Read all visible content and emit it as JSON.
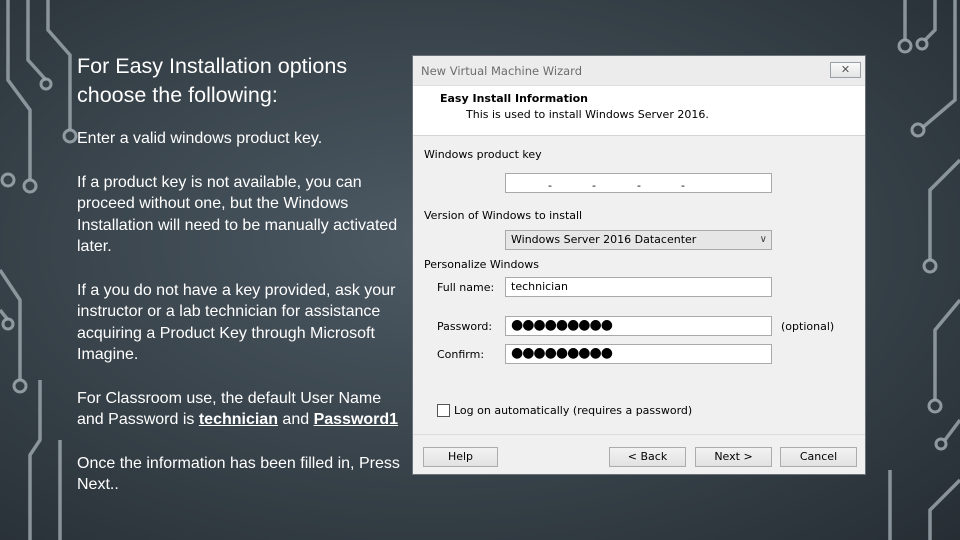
{
  "slide": {
    "heading": "For Easy Installation options choose the following:",
    "p1": "Enter a valid windows product key.",
    "p2": "If a product key is not available, you can proceed without one, but the Windows Installation will need to be manually activated later.",
    "p3": "If a you do not have a key provided, ask your instructor or a lab technician for assistance acquiring a Product Key through Microsoft Imagine.",
    "p4_pre": "For Classroom use,  the default User Name and Password is ",
    "p4_user": "technician",
    "p4_mid": " and ",
    "p4_pass": "Password1",
    "p5": "Once the information has been filled in, Press Next.."
  },
  "dialog": {
    "title": "New Virtual Machine Wizard",
    "close_glyph": "✕",
    "header_title": "Easy Install Information",
    "header_subtitle": "This is used to install Windows Server 2016.",
    "product_key_label": "Windows product key",
    "product_key_value": "",
    "version_label": "Version of Windows to install",
    "version_value": "Windows Server 2016 Datacenter",
    "version_arrow": "∨",
    "personalize_label": "Personalize Windows",
    "fullname_label": "Full name:",
    "fullname_value": "technician",
    "password_label": "Password:",
    "password_value": "●●●●●●●●●",
    "optional_label": "(optional)",
    "confirm_label": "Confirm:",
    "confirm_value": "●●●●●●●●●",
    "autologon_label": "Log on automatically (requires a password)",
    "autologon_checked": false,
    "buttons": {
      "help": "Help",
      "back": "< Back",
      "next": "Next >",
      "cancel": "Cancel"
    }
  }
}
